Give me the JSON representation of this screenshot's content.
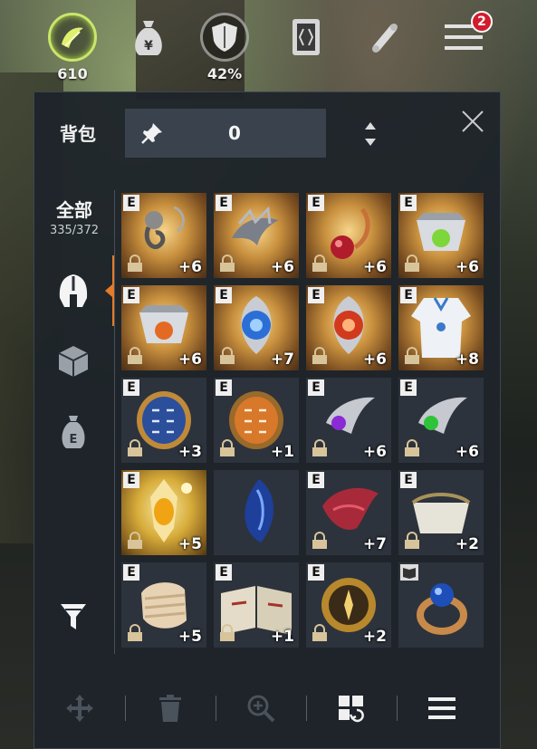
{
  "hud": {
    "energy_value": "610",
    "percent_value": "42%",
    "menu_badge": "2"
  },
  "panel": {
    "title": "背包",
    "pin_value": "0",
    "tab_all_label": "全部",
    "tab_all_count": "335/372"
  },
  "grid": [
    {
      "e": "E",
      "plus": "+6",
      "icon": "earring-icon",
      "bg": "rare"
    },
    {
      "e": "E",
      "plus": "+6",
      "icon": "dragon-necklace-icon",
      "bg": "rare"
    },
    {
      "e": "E",
      "plus": "+6",
      "icon": "ruby-pendant-icon",
      "bg": "rare"
    },
    {
      "e": "E",
      "plus": "+6",
      "icon": "green-gem-collar-icon",
      "bg": "rare"
    },
    {
      "e": "E",
      "plus": "+6",
      "icon": "orange-gem-collar-icon",
      "bg": "rare"
    },
    {
      "e": "E",
      "plus": "+7",
      "icon": "blue-orb-amulet-icon",
      "bg": "rare"
    },
    {
      "e": "E",
      "plus": "+6",
      "icon": "red-orb-amulet-icon",
      "bg": "rare"
    },
    {
      "e": "E",
      "plus": "+8",
      "icon": "white-robe-icon",
      "bg": "rare"
    },
    {
      "e": "E",
      "plus": "+3",
      "icon": "blue-rune-stone-icon",
      "bg": "plain"
    },
    {
      "e": "E",
      "plus": "+1",
      "icon": "orange-rune-stone-icon",
      "bg": "plain"
    },
    {
      "e": "E",
      "plus": "+6",
      "icon": "purple-gem-wing-icon",
      "bg": "plain"
    },
    {
      "e": "E",
      "plus": "+6",
      "icon": "green-gem-wing-icon",
      "bg": "plain"
    },
    {
      "e": "E",
      "plus": "+5",
      "icon": "golden-amber-brooch-icon",
      "bg": "epic"
    },
    {
      "e": "",
      "plus": "",
      "icon": "blue-crystal-icon",
      "bg": "plain"
    },
    {
      "e": "E",
      "plus": "+7",
      "icon": "red-feather-mask-icon",
      "bg": "plain"
    },
    {
      "e": "E",
      "plus": "+2",
      "icon": "white-collar-icon",
      "bg": "plain"
    },
    {
      "e": "E",
      "plus": "+5",
      "icon": "bandaged-fist-icon",
      "bg": "plain"
    },
    {
      "e": "E",
      "plus": "+1",
      "icon": "open-book-icon",
      "bg": "plain"
    },
    {
      "e": "E",
      "plus": "+2",
      "icon": "golden-compass-icon",
      "bg": "plain"
    },
    {
      "e": "",
      "plus": "",
      "icon": "sapphire-ring-icon",
      "bg": "plain",
      "book": true
    }
  ],
  "colors": {
    "accent": "#e47a2a",
    "badge": "#d11d2d",
    "energy": "#c9e66a"
  }
}
